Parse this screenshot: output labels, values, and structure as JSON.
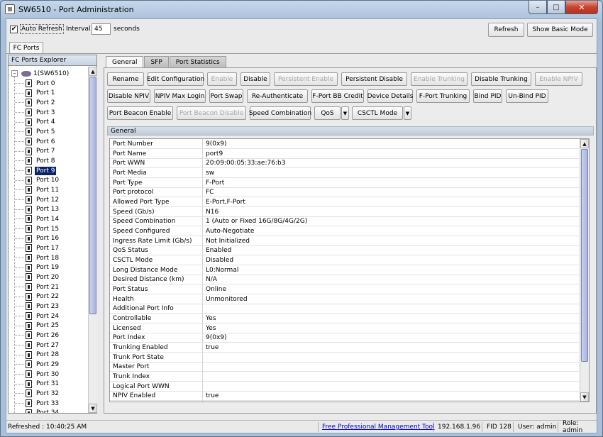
{
  "window": {
    "title": "SW6510 - Port Administration"
  },
  "toolbar": {
    "auto_refresh_label": "Auto Refresh",
    "auto_refresh_checked": true,
    "interval_label": "Interval",
    "interval_value": "45",
    "seconds_label": "seconds",
    "refresh_label": "Refresh",
    "show_basic_label": "Show Basic Mode"
  },
  "main_tab": "FC Ports",
  "explorer": {
    "title": "FC Ports Explorer",
    "root": "1(SW6510)",
    "selected": "Port 9",
    "ports": [
      "Port 0",
      "Port 1",
      "Port 2",
      "Port 3",
      "Port 4",
      "Port 5",
      "Port 6",
      "Port 7",
      "Port 8",
      "Port 9",
      "Port 10",
      "Port 11",
      "Port 12",
      "Port 13",
      "Port 14",
      "Port 15",
      "Port 16",
      "Port 17",
      "Port 18",
      "Port 19",
      "Port 20",
      "Port 21",
      "Port 22",
      "Port 23",
      "Port 24",
      "Port 25",
      "Port 26",
      "Port 27",
      "Port 28",
      "Port 29",
      "Port 30",
      "Port 31",
      "Port 32",
      "Port 33",
      "Port 34"
    ]
  },
  "tabs": [
    {
      "label": "General",
      "active": true
    },
    {
      "label": "SFP",
      "active": false
    },
    {
      "label": "Port Statistics",
      "active": false
    }
  ],
  "action_rows": [
    [
      {
        "label": "Rename",
        "enabled": true
      },
      {
        "label": "Edit Configuration",
        "enabled": true
      },
      {
        "label": "Enable",
        "enabled": false
      },
      {
        "label": "Disable",
        "enabled": true
      },
      {
        "label": "Persistent Enable",
        "enabled": false
      },
      {
        "label": "Persistent Disable",
        "enabled": true
      },
      {
        "label": "Enable Trunking",
        "enabled": false
      },
      {
        "label": "Disable Trunking",
        "enabled": true
      },
      {
        "label": "Enable NPIV",
        "enabled": false
      }
    ],
    [
      {
        "label": "Disable NPIV",
        "enabled": true
      },
      {
        "label": "NPIV Max Login",
        "enabled": true
      },
      {
        "label": "Port Swap",
        "enabled": true
      },
      {
        "label": "Re-Authenticate",
        "enabled": true
      },
      {
        "label": "F-Port BB Credit",
        "enabled": true
      },
      {
        "label": "Device Details",
        "enabled": true
      },
      {
        "label": "F-Port Trunking",
        "enabled": true
      },
      {
        "label": "Bind PID",
        "enabled": true
      },
      {
        "label": "Un-Bind PID",
        "enabled": true
      }
    ],
    [
      {
        "label": "Port Beacon Enable",
        "enabled": true
      },
      {
        "label": "Port Beacon Disable",
        "enabled": false
      },
      {
        "label": "Speed Combination",
        "enabled": true
      },
      {
        "label": "QoS",
        "enabled": true,
        "dropdown": true
      },
      {
        "label": "CSCTL Mode",
        "enabled": true,
        "dropdown": true
      }
    ]
  ],
  "section_title": "General",
  "properties": [
    {
      "key": "Port Number",
      "value": "9(0x9)"
    },
    {
      "key": "Port Name",
      "value": "port9"
    },
    {
      "key": "Port WWN",
      "value": "20:09:00:05:33:ae:76:b3"
    },
    {
      "key": "Port Media",
      "value": "sw"
    },
    {
      "key": "Port Type",
      "value": "F-Port"
    },
    {
      "key": "Port protocol",
      "value": "FC"
    },
    {
      "key": "Allowed Port Type",
      "value": "E-Port,F-Port"
    },
    {
      "key": "Speed (Gb/s)",
      "value": "N16"
    },
    {
      "key": "Speed Combination",
      "value": "1 (Auto or Fixed 16G/8G/4G/2G)"
    },
    {
      "key": "Speed Configured",
      "value": "Auto-Negotiate"
    },
    {
      "key": "Ingress Rate Limit (Gb/s)",
      "value": "Not Initialized"
    },
    {
      "key": "QoS Status",
      "value": "Enabled"
    },
    {
      "key": "CSCTL Mode",
      "value": "Disabled"
    },
    {
      "key": "Long Distance Mode",
      "value": "L0:Normal"
    },
    {
      "key": "Desired Distance (km)",
      "value": "N/A"
    },
    {
      "key": "Port Status",
      "value": "Online"
    },
    {
      "key": "Health",
      "value": "Unmonitored"
    },
    {
      "key": "Additional Port Info",
      "value": ""
    },
    {
      "key": "Controllable",
      "value": "Yes"
    },
    {
      "key": "Licensed",
      "value": "Yes"
    },
    {
      "key": "Port Index",
      "value": "9(0x9)"
    },
    {
      "key": "Trunking Enabled",
      "value": "true"
    },
    {
      "key": "Trunk Port State",
      "value": ""
    },
    {
      "key": "Master Port",
      "value": ""
    },
    {
      "key": "Trunk Index",
      "value": ""
    },
    {
      "key": "Logical Port WWN",
      "value": ""
    },
    {
      "key": "NPIV Enabled",
      "value": "true"
    }
  ],
  "status": {
    "refreshed": "Refreshed : 10:40:25 AM",
    "link": "Free Professional Management Tool",
    "ip": "192.168.1.96",
    "fid": "FID 128",
    "user": "User: admin",
    "role": "Role: admin"
  }
}
